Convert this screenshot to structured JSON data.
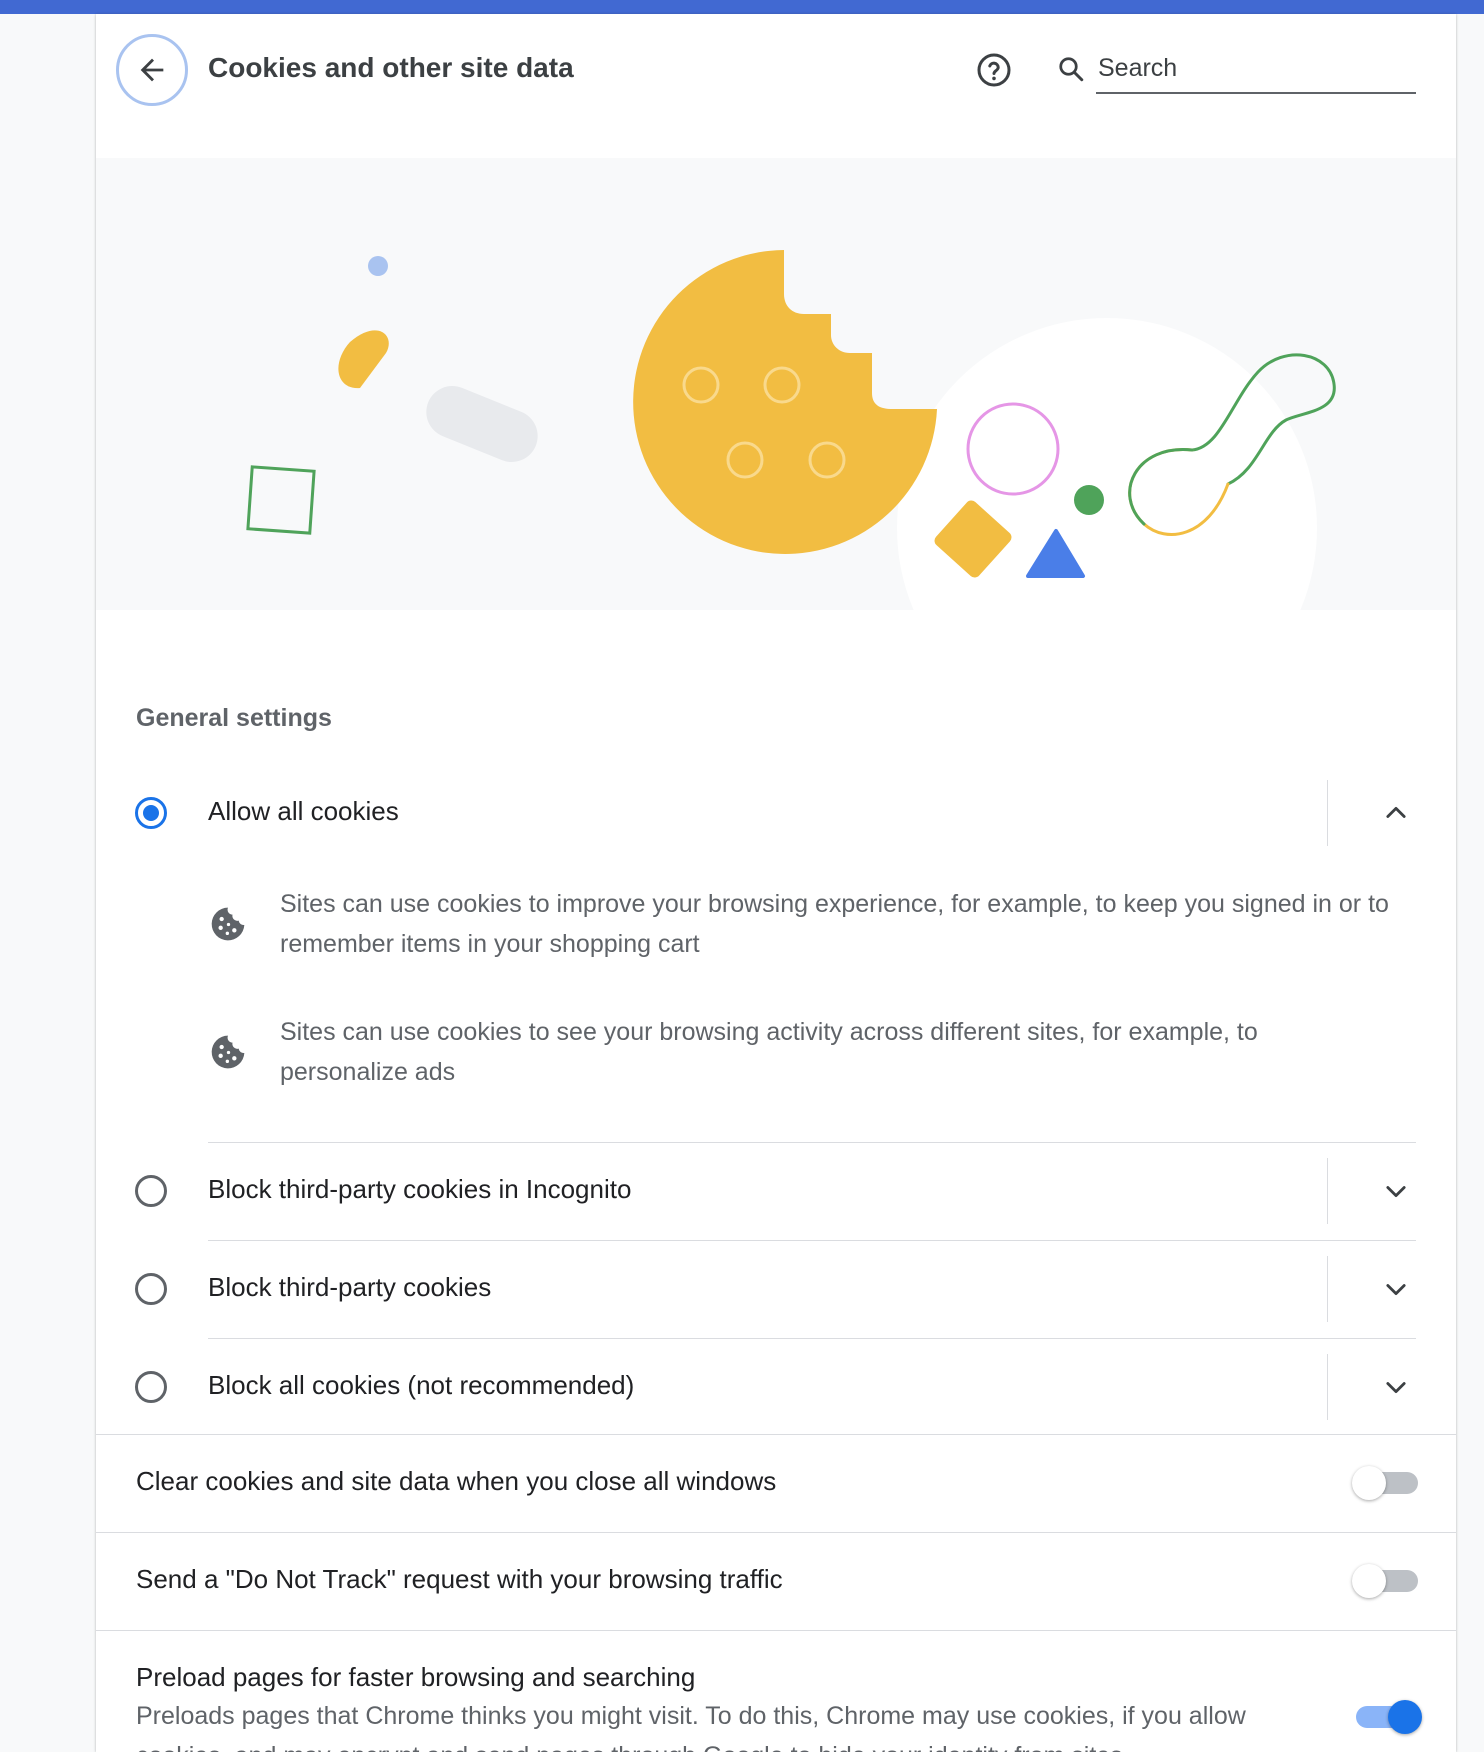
{
  "colors": {
    "top_bar": "#4169d2",
    "accent": "#1a73e8",
    "cookie_yellow": "#f2bd42",
    "shape_green": "#4fa35a",
    "shape_pink": "#e596e6",
    "shape_blue": "#4a7ee8"
  },
  "header": {
    "title": "Cookies and other site data",
    "search_placeholder": "Search",
    "icons": [
      "back-arrow-icon",
      "help-icon",
      "search-icon"
    ]
  },
  "general": {
    "title": "General settings",
    "options": [
      {
        "label": "Allow all cookies",
        "selected": true,
        "expanded": true,
        "details": [
          "Sites can use cookies to improve your browsing experience, for example, to keep you signed in or to remember items in your shopping cart",
          "Sites can use cookies to see your browsing activity across different sites, for example, to personalize ads"
        ]
      },
      {
        "label": "Block third-party cookies in Incognito",
        "selected": false,
        "expanded": false
      },
      {
        "label": "Block third-party cookies",
        "selected": false,
        "expanded": false
      },
      {
        "label": "Block all cookies (not recommended)",
        "selected": false,
        "expanded": false
      }
    ]
  },
  "toggles": [
    {
      "label": "Clear cookies and site data when you close all windows",
      "on": false
    },
    {
      "label": "Send a \"Do Not Track\" request with your browsing traffic",
      "on": false
    },
    {
      "label": "Preload pages for faster browsing and searching",
      "sublabel": "Preloads pages that Chrome thinks you might visit. To do this, Chrome may use cookies, if you allow cookies, and may encrypt and send pages through Google to hide your identity from sites.",
      "on": true
    }
  ]
}
